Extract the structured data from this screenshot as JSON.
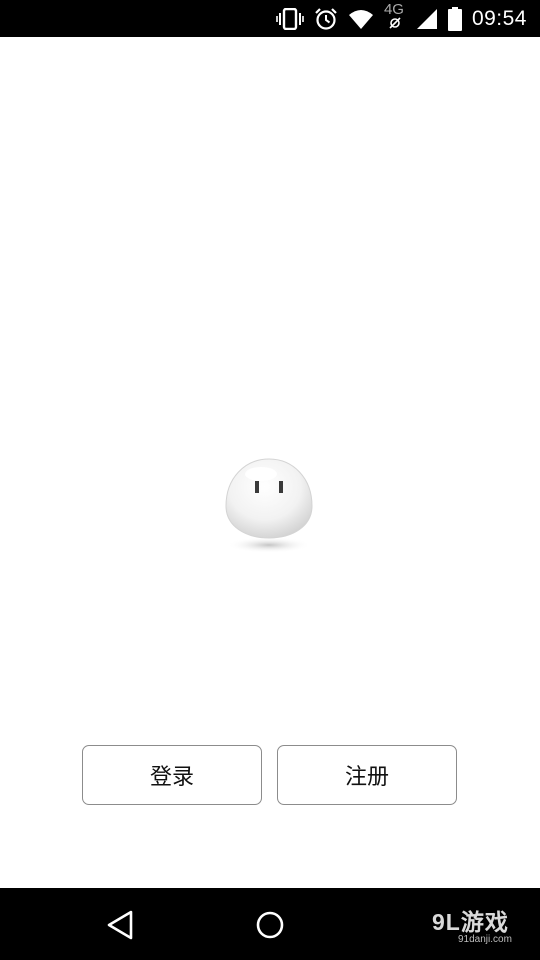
{
  "status_bar": {
    "time": "09:54",
    "network_label": "4G",
    "icons": [
      "vibrate-icon",
      "alarm-icon",
      "wifi-icon",
      "cellular-signal-icon",
      "battery-icon"
    ]
  },
  "mascot": {
    "icon": "mascot-blob-icon"
  },
  "actions": {
    "login_label": "登录",
    "register_label": "注册"
  },
  "nav_bar": {
    "icons": [
      "back-icon",
      "home-icon"
    ]
  },
  "watermark": {
    "logo_text": "9L游戏",
    "url_text": "91danji.com"
  },
  "colors": {
    "status_bar_bg": "#000000",
    "screen_bg": "#ffffff",
    "button_border": "#8c8c8c",
    "nav_bar_bg": "#000000"
  }
}
